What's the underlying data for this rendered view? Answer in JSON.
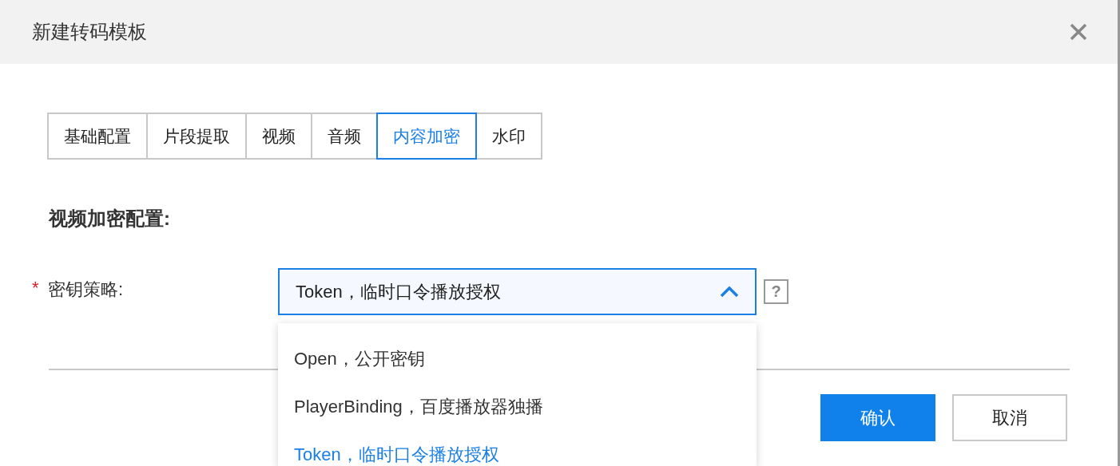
{
  "dialog": {
    "title": "新建转码模板"
  },
  "tabs": [
    {
      "label": "基础配置",
      "selected": false
    },
    {
      "label": "片段提取",
      "selected": false
    },
    {
      "label": "视频",
      "selected": false
    },
    {
      "label": "音频",
      "selected": false
    },
    {
      "label": "内容加密",
      "selected": true
    },
    {
      "label": "水印",
      "selected": false
    }
  ],
  "section_title": "视频加密配置:",
  "field": {
    "label": "密钥策略:",
    "required": true,
    "required_mark": "*",
    "value": "Token，临时口令播放授权",
    "expanded": true,
    "help": "?",
    "options": [
      {
        "label": "Open，公开密钥",
        "selected": false
      },
      {
        "label": "PlayerBinding，百度播放器独播",
        "selected": false
      },
      {
        "label": "Token，临时口令播放授权",
        "selected": true
      }
    ]
  },
  "buttons": [
    {
      "label": "确认",
      "kind": "primary"
    },
    {
      "label": "取消",
      "kind": "secondary"
    }
  ]
}
